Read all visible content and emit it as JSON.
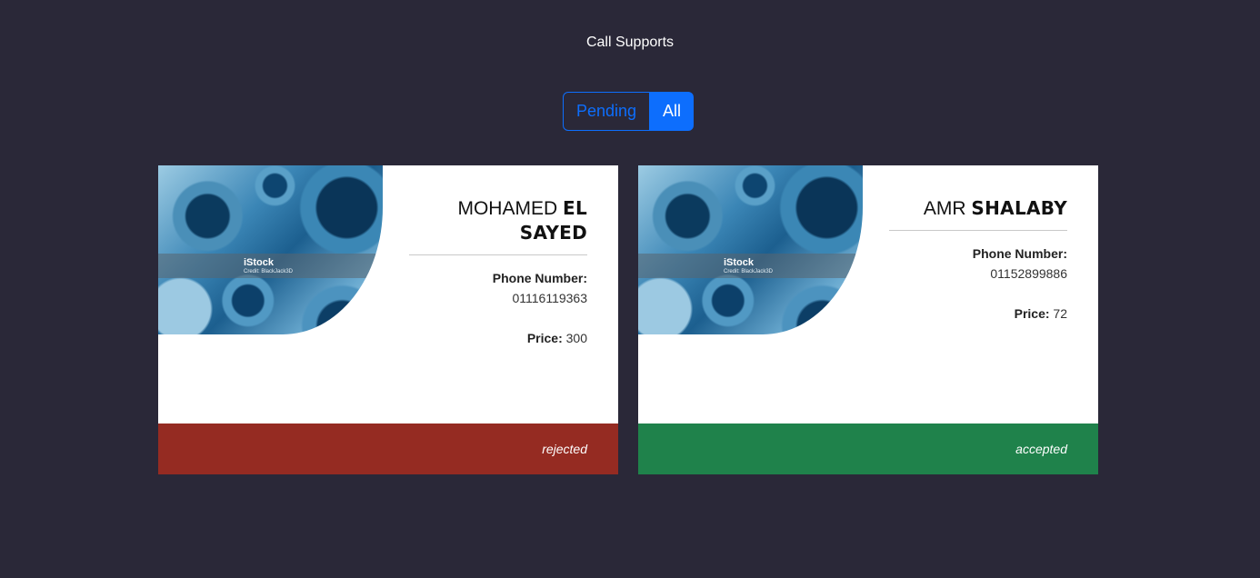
{
  "header": {
    "title": "Call Supports"
  },
  "filters": {
    "pending_label": "Pending",
    "all_label": "All",
    "active": "All"
  },
  "cards": [
    {
      "first_name": "MOHAMED",
      "last_name": "EL SAYED",
      "phone_label": "Phone Number:",
      "phone": "01116119363",
      "price_label": "Price:",
      "price": "300",
      "status": "rejected",
      "status_color": "#952b22",
      "image": {
        "brand": "iStock",
        "credit": "Credit: BlackJack3D"
      }
    },
    {
      "first_name": "AMR",
      "last_name": "SHALABY",
      "phone_label": "Phone Number:",
      "phone": "01152899886",
      "price_label": "Price:",
      "price": "72",
      "status": "accepted",
      "status_color": "#1f824b",
      "image": {
        "brand": "iStock",
        "credit": "Credit: BlackJack3D"
      }
    }
  ],
  "colors": {
    "background": "#2a2838",
    "accent": "#0d6efd",
    "card": "#ffffff"
  }
}
